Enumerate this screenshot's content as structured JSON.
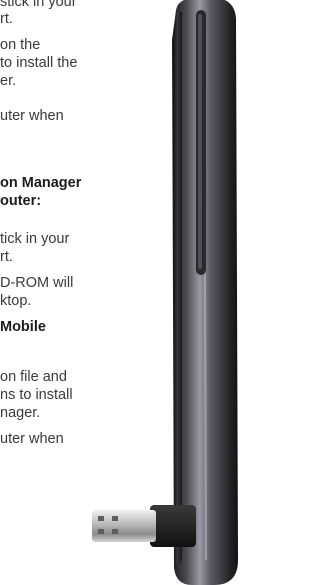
{
  "text_lines": [
    "stick in your",
    "rt.",
    "on the",
    "to install the",
    "er.",
    "uter when",
    "on Manager",
    "outer:",
    "tick in your",
    "rt.",
    "D-ROM will",
    "ktop.",
    "Mobile",
    "on file and",
    "ns to install",
    "nager.",
    "uter when"
  ]
}
